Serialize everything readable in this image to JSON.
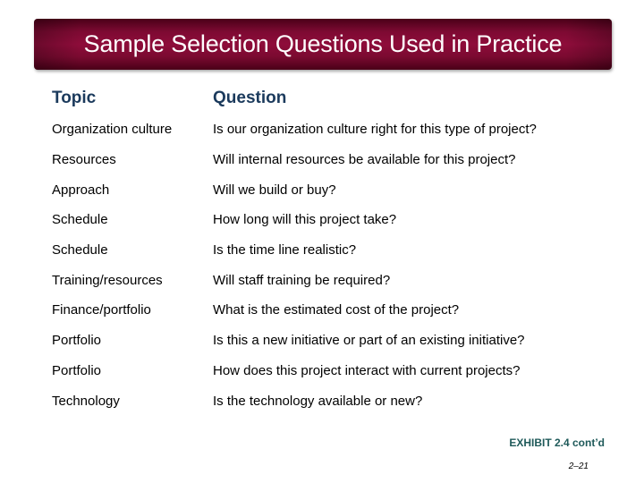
{
  "title": "Sample Selection Questions Used in Practice",
  "colors": {
    "banner": "#8e0c3a",
    "header_text": "#1b3a5c",
    "exhibit_text": "#1f5a5a"
  },
  "table": {
    "headers": [
      "Topic",
      "Question"
    ],
    "rows": [
      {
        "topic": "Organization culture",
        "question": "Is our organization culture right for this type of project?"
      },
      {
        "topic": "Resources",
        "question": "Will internal resources be available for this project?"
      },
      {
        "topic": "Approach",
        "question": "Will we build or buy?"
      },
      {
        "topic": "Schedule",
        "question": "How long will this project take?"
      },
      {
        "topic": "Schedule",
        "question": "Is the time line realistic?"
      },
      {
        "topic": "Training/resources",
        "question": "Will staff training be required?"
      },
      {
        "topic": "Finance/portfolio",
        "question": "What is the estimated cost of the project?"
      },
      {
        "topic": "Portfolio",
        "question": "Is this a new initiative or part of an existing initiative?"
      },
      {
        "topic": "Portfolio",
        "question": "How does this project interact with current projects?"
      },
      {
        "topic": "Technology",
        "question": "Is the technology available or new?"
      }
    ]
  },
  "exhibit": "EXHIBIT 2.4 cont’d",
  "page_number": "2–21"
}
